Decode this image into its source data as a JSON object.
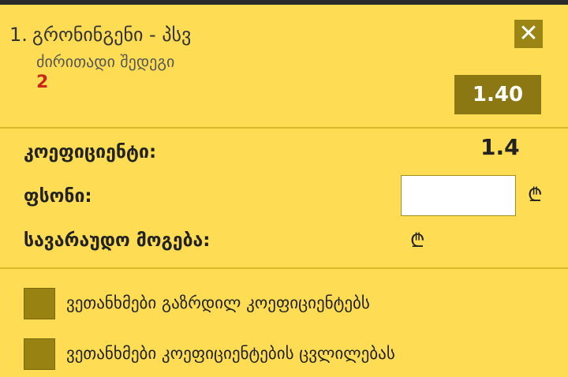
{
  "bet": {
    "index": "1.",
    "title": "გრონინგენი - პსვ",
    "market": "ძირითადი შედეგი",
    "selection": "2",
    "odds": "1.40"
  },
  "summary": {
    "coefficient_label": "კოეფიციენტი:",
    "coefficient_value": "1.4",
    "stake_label": "ფსონი:",
    "stake_value": "",
    "potential_win_label": "სავარაუდო მოგება:",
    "currency": "₾"
  },
  "options": [
    {
      "label": "ვეთანხმები გაზრდილ კოეფიციენტებს"
    },
    {
      "label": "ვეთანხმები კოეფიციენტების ცვლილებას"
    }
  ],
  "colors": {
    "background": "#fedd55",
    "button": "#8b7813",
    "selection": "#c8271c"
  }
}
